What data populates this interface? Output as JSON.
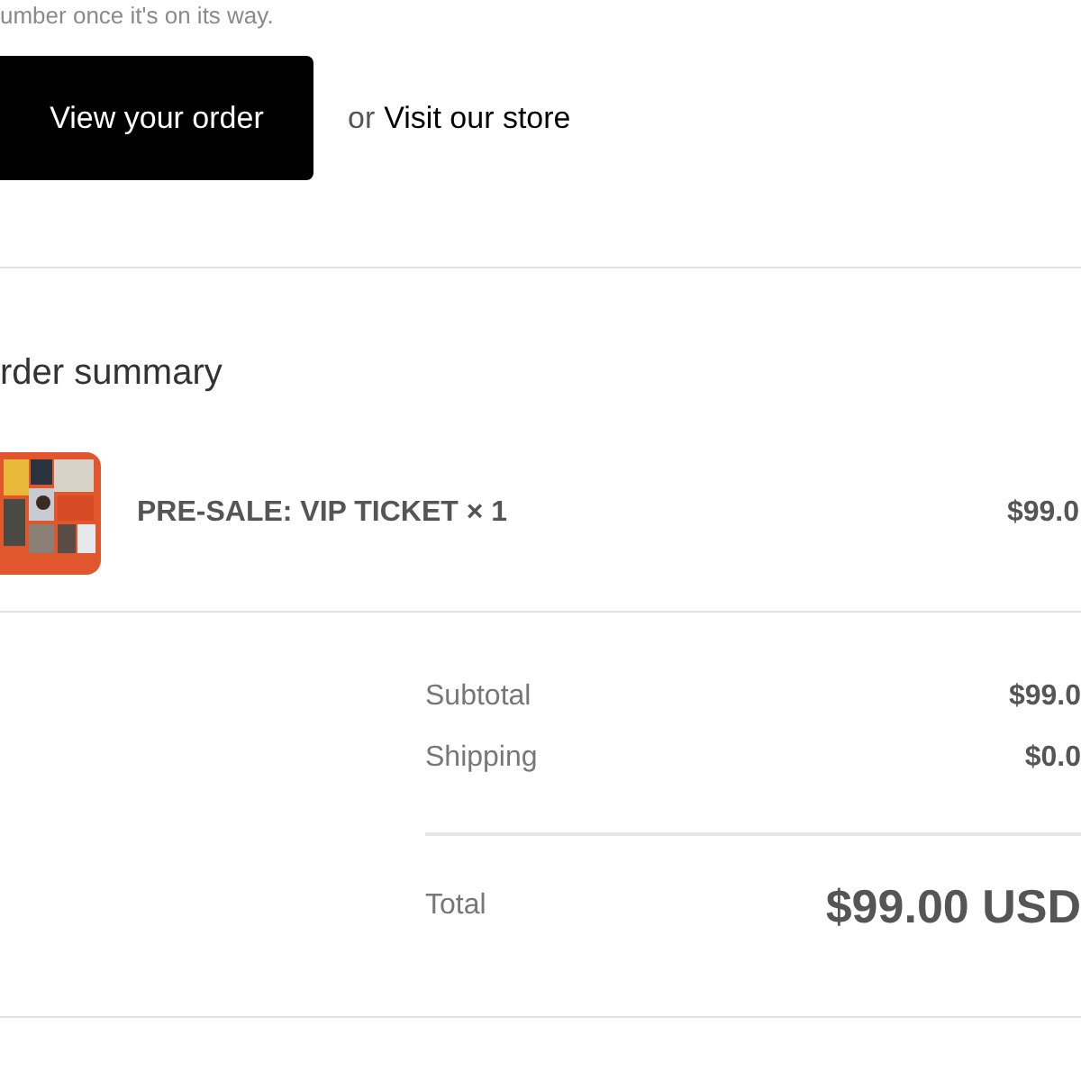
{
  "intro_text": "umber once it's on its way.",
  "actions": {
    "primary_button": "View your order",
    "separator": "or",
    "link": "Visit our store"
  },
  "order_summary": {
    "title": "rder summary",
    "items": [
      {
        "name": "PRE-SALE: VIP TICKET × 1",
        "price": "$99.0"
      }
    ],
    "lines": [
      {
        "label": "Subtotal",
        "value": "$99.0"
      },
      {
        "label": "Shipping",
        "value": "$0.0"
      }
    ],
    "total": {
      "label": "Total",
      "value": "$99.00 USD"
    }
  }
}
